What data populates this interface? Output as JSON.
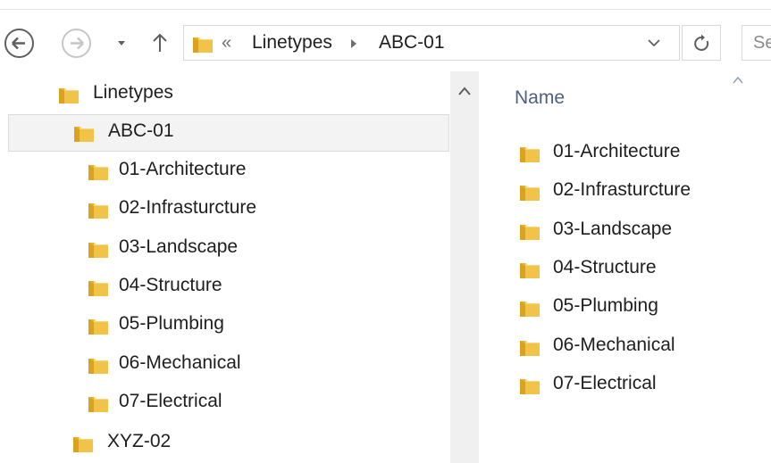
{
  "colors": {
    "folder": "#e8b531",
    "folder_light": "#f7d77a",
    "header_text": "#4d6082",
    "selected_bg": "#f3f3f3"
  },
  "toolbar": {
    "back_icon": "back-arrow-icon",
    "forward_icon": "forward-arrow-icon",
    "recent_icon": "chevron-down-icon",
    "up_icon": "up-arrow-icon",
    "refresh_icon": "refresh-icon"
  },
  "address": {
    "chevrons": "«",
    "crumbs": [
      "Linetypes",
      "ABC-01"
    ]
  },
  "search": {
    "placeholder": "Se"
  },
  "nav_tree": {
    "root": "Linetypes",
    "selected": "ABC-01",
    "children": [
      "01-Architecture",
      "02-Infrasturcture",
      "03-Landscape",
      "04-Structure",
      "05-Plumbing",
      "06-Mechanical",
      "07-Electrical"
    ],
    "sibling": "XYZ-02"
  },
  "content": {
    "column_name": "Name",
    "items": [
      "01-Architecture",
      "02-Infrasturcture",
      "03-Landscape",
      "04-Structure",
      "05-Plumbing",
      "06-Mechanical",
      "07-Electrical"
    ]
  }
}
